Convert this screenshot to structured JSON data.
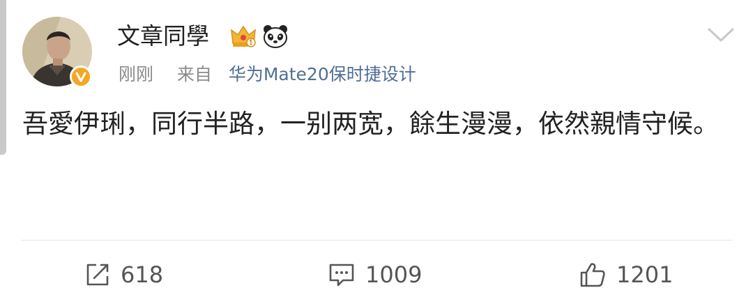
{
  "post": {
    "username": "文章同學",
    "time": "刚刚",
    "source_prefix": "来自",
    "source": "华为Mate20保时捷设计",
    "text": "吾愛伊琍，同行半路，一别两宽，餘生漫漫，依然親情守候。",
    "badges": [
      "crown-icon",
      "panda-icon"
    ]
  },
  "actions": {
    "repost_count": "618",
    "comment_count": "1009",
    "like_count": "1201"
  },
  "colors": {
    "link": "#4f6f97",
    "meta": "#8a8a8a",
    "verified_badge": "#f5a623"
  }
}
